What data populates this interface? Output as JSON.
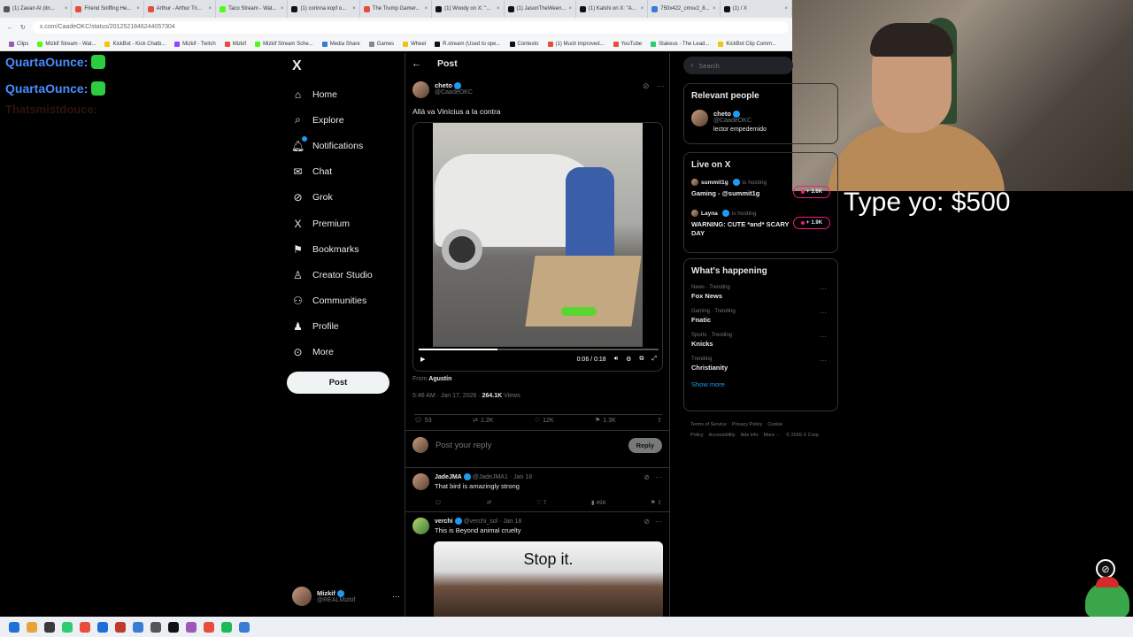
{
  "browser": {
    "tabs": [
      {
        "label": "(1) Zavan AI (itn...",
        "color": "#555"
      },
      {
        "label": "Friend Sniffing He...",
        "color": "#e74c3c"
      },
      {
        "label": "Arthur - Arthur Tri...",
        "color": "#e74c3c"
      },
      {
        "label": "Taco Stream - Wat...",
        "color": "#53fc18"
      },
      {
        "label": "(1) corinna kopf o...",
        "color": "#111"
      },
      {
        "label": "The Trump Gamer...",
        "color": "#e74c3c"
      },
      {
        "label": "(1) Woody on X: \"...",
        "color": "#111"
      },
      {
        "label": "(1) JasonTheWeen...",
        "color": "#111"
      },
      {
        "label": "(1) Kalshi on X: \"A...",
        "color": "#111"
      },
      {
        "label": "750x422_cmsv2_8...",
        "color": "#3a7bd5"
      },
      {
        "label": "(1) / X",
        "color": "#111"
      }
    ],
    "url": "x.com/CaadeOKC/status/2012521846244057304",
    "bookmarks": [
      {
        "label": "Clips",
        "color": "#9b59b6"
      },
      {
        "label": "Mizkif Stream - Wat...",
        "color": "#53fc18"
      },
      {
        "label": "KickBot - Kick Chatb...",
        "color": "#f1c40f"
      },
      {
        "label": "Mizkif - Twitch",
        "color": "#9146ff"
      },
      {
        "label": "Mizkif",
        "color": "#e74c3c"
      },
      {
        "label": "Mizkif Stream Sche...",
        "color": "#53fc18"
      },
      {
        "label": "Media Share",
        "color": "#3a7bd5"
      },
      {
        "label": "Games",
        "color": "#888"
      },
      {
        "label": "Wheel",
        "color": "#f1c40f"
      },
      {
        "label": "R.stream (Used to ope...",
        "color": "#111"
      },
      {
        "label": "Contexto",
        "color": "#111"
      },
      {
        "label": "(1) Much improved...",
        "color": "#e74c3c"
      },
      {
        "label": "YouTube",
        "color": "#e74c3c"
      },
      {
        "label": "Stakeus - The Lead...",
        "color": "#2ecc71"
      },
      {
        "label": "KickBot Clip Comm...",
        "color": "#f1c40f"
      }
    ]
  },
  "overlay": {
    "chat_lines": [
      {
        "name": "QuartaOunce:"
      },
      {
        "name": "QuartaOunce:"
      }
    ],
    "faded_line": "Thatsmistdouce:",
    "alert": "Type yo: $500"
  },
  "x": {
    "logo": "X",
    "nav": [
      {
        "label": "Home",
        "icon": "home-icon",
        "glyph": "⌂"
      },
      {
        "label": "Explore",
        "icon": "search-icon",
        "glyph": "⌕"
      },
      {
        "label": "Notifications",
        "icon": "bell-icon",
        "glyph": "🔔︎"
      },
      {
        "label": "Chat",
        "icon": "mail-icon",
        "glyph": "✉"
      },
      {
        "label": "Grok",
        "icon": "grok-icon",
        "glyph": "⊘"
      },
      {
        "label": "Premium",
        "icon": "x-premium-icon",
        "glyph": "X"
      },
      {
        "label": "Bookmarks",
        "icon": "bookmark-icon",
        "glyph": "⚑"
      },
      {
        "label": "Creator Studio",
        "icon": "creator-icon",
        "glyph": "♙"
      },
      {
        "label": "Communities",
        "icon": "communities-icon",
        "glyph": "⚇"
      },
      {
        "label": "Profile",
        "icon": "profile-icon",
        "glyph": "♟"
      },
      {
        "label": "More",
        "icon": "more-icon",
        "glyph": "⊙"
      }
    ],
    "post_button": "Post",
    "account": {
      "name": "Mizkif",
      "handle": "@REALMizkif",
      "more": "···"
    },
    "header": {
      "back": "←",
      "title": "Post"
    },
    "post": {
      "name": "cheto",
      "handle": "@CaadeOKC",
      "text": "Allá va Vinícius a la contra",
      "video": {
        "time": "0:06 / 0:18",
        "progress": 0.33
      },
      "from_label": "From",
      "from_name": "Agustín",
      "timestamp": "5:46 AM · Jan 17, 2026 ·",
      "views": "264.1K",
      "views_label": "Views",
      "actions": {
        "replies": "53",
        "reposts": "1.2K",
        "likes": "12K",
        "bookmarks": "1.3K"
      }
    },
    "reply_box": {
      "placeholder": "Post your reply",
      "button": "Reply"
    },
    "replies": [
      {
        "name": "JadeJMA",
        "handle": "@JadeJMA1 · Jan 18",
        "text": "That bird is amazingly strong",
        "reposts": "",
        "likes": "7",
        "views": "498"
      },
      {
        "name": "verchi",
        "handle": "@verchi_sol · Jan 18",
        "text": "This is Beyond animal cruelty",
        "meme_caption": "Stop it."
      }
    ],
    "search": {
      "placeholder": "Search"
    },
    "relevant": {
      "title": "Relevant people",
      "name": "cheto",
      "handle": "@CaadeOKC",
      "bio": "lector empedernido"
    },
    "live": {
      "title": "Live on X",
      "items": [
        {
          "host": "summit1g",
          "status": "is hosting",
          "title": "Gaming - @summit1g",
          "count": "3.6K"
        },
        {
          "host": "Layna",
          "status": "is hosting",
          "title": "WARNING: CUTE *and* SCARY DAY",
          "count": "1.9K"
        }
      ]
    },
    "happening": {
      "title": "What's happening",
      "trends": [
        {
          "category": "News · Trending",
          "name": "Fox News"
        },
        {
          "category": "Gaming · Trending",
          "name": "Fnatic"
        },
        {
          "category": "Sports · Trending",
          "name": "Knicks"
        },
        {
          "category": "Trending",
          "name": "Christianity"
        }
      ],
      "show_more": "Show more"
    },
    "footer": [
      "Terms of Service",
      "Privacy Policy",
      "Cookie Policy",
      "Accessibility",
      "Ads info",
      "More ···",
      "© 2026 X Corp."
    ]
  }
}
